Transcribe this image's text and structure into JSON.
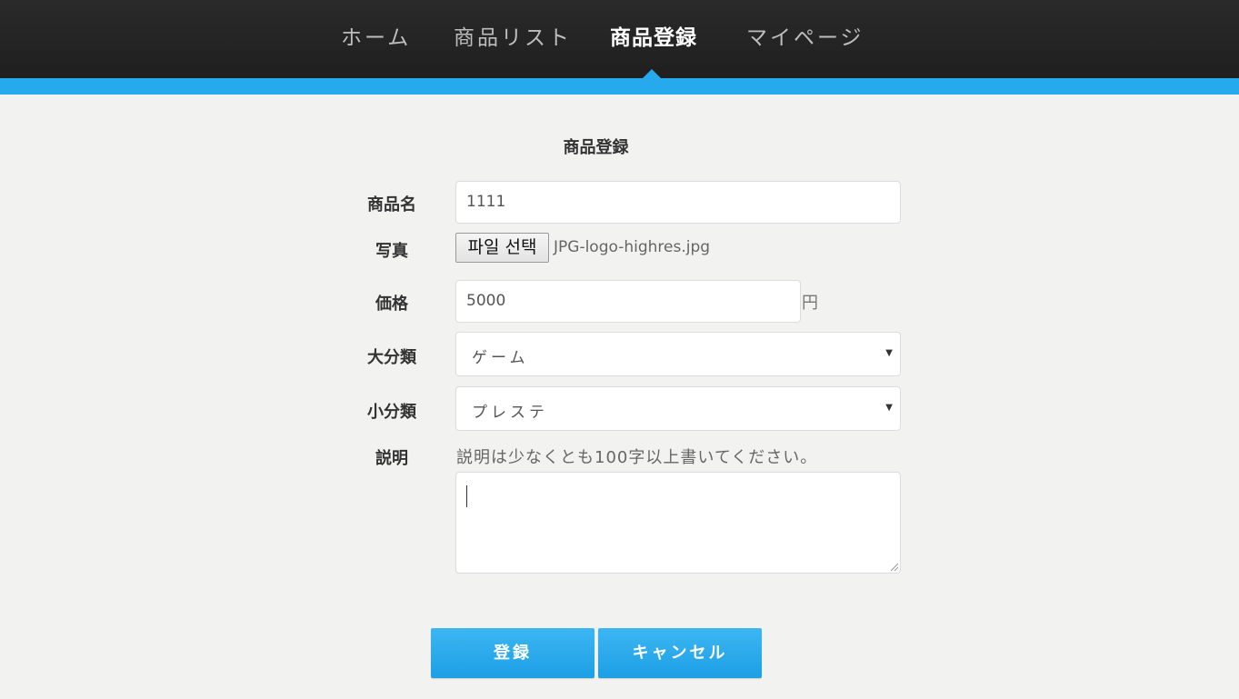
{
  "nav": {
    "items": [
      {
        "label": "ホーム"
      },
      {
        "label": "商品リスト"
      },
      {
        "label": "商品登録",
        "active": true
      },
      {
        "label": "マイページ"
      }
    ]
  },
  "form": {
    "title": "商品登録",
    "name_label": "商品名",
    "name_value": "1111",
    "photo_label": "写真",
    "file_button_label": "파일 선택",
    "file_name": "JPG-logo-highres.jpg",
    "price_label": "価格",
    "price_value": "5000",
    "price_unit": "円",
    "category_label": "大分類",
    "category_value": "ゲーム",
    "subcategory_label": "小分類",
    "subcategory_value": "プレステ",
    "description_label": "説明",
    "description_hint": "説明は少なくとも100字以上書いてください。",
    "description_value": ""
  },
  "buttons": {
    "submit_label": "登録",
    "cancel_label": "キャンセル"
  },
  "colors": {
    "accent": "#27a9ee",
    "nav_bg": "#222222",
    "page_bg": "#f2f2f1"
  },
  "icons": {
    "select_arrow": "chevron-down-icon"
  }
}
